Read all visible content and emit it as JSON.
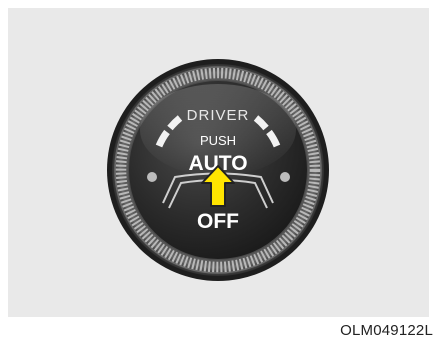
{
  "knob": {
    "label_top": "DRIVER",
    "label_push": "PUSH",
    "label_auto": "AUTO",
    "label_off": "OFF"
  },
  "caption": "OLM049122L",
  "colors": {
    "panel": "#e9e9e9",
    "arrow_fill": "#ffe400",
    "knob_face": "#2a2a2a"
  },
  "icons": {
    "arrow": "up-arrow-icon"
  }
}
